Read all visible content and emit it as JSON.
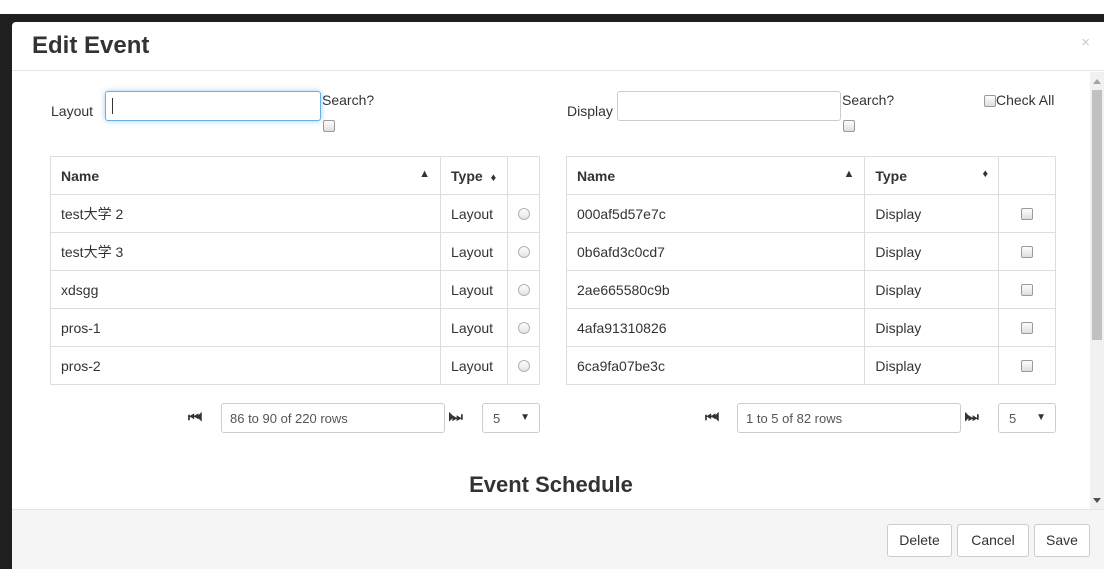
{
  "modal": {
    "title": "Edit Event",
    "close_symbol": "×"
  },
  "left_panel": {
    "filter_label": "Layout",
    "filter_value": "",
    "search_label": "Search?",
    "search_checked": false,
    "columns": [
      "Name",
      "Type"
    ],
    "sort_name": "▲",
    "sort_type": "♦",
    "rows": [
      {
        "name": "test大学 2",
        "type": "Layout"
      },
      {
        "name": "test大学 3",
        "type": "Layout"
      },
      {
        "name": "xdsgg",
        "type": "Layout"
      },
      {
        "name": "pros-1",
        "type": "Layout"
      },
      {
        "name": "pros-2",
        "type": "Layout"
      }
    ],
    "pager": {
      "first_prev_icons": "⏮⏴",
      "text": "86 to 90 of 220 rows",
      "next_last_icons": "⏵⏭",
      "page_size": "5",
      "dropdown_icon": "▼"
    }
  },
  "right_panel": {
    "filter_label": "Display",
    "filter_value": "",
    "search_label": "Search?",
    "search_checked": false,
    "check_all_label": "Check All",
    "columns": [
      "Name",
      "Type"
    ],
    "sort_name": "▲",
    "sort_type": "♦",
    "rows": [
      {
        "name": "000af5d57e7c",
        "type": "Display"
      },
      {
        "name": "0b6afd3c0cd7",
        "type": "Display"
      },
      {
        "name": "2ae665580c9b",
        "type": "Display"
      },
      {
        "name": "4afa91310826",
        "type": "Display"
      },
      {
        "name": "6ca9fa07be3c",
        "type": "Display"
      }
    ],
    "pager": {
      "first_prev_icons": "⏮⏴",
      "text": "1 to 5 of 82 rows",
      "next_last_icons": "⏵⏭",
      "page_size": "5",
      "dropdown_icon": "▼"
    }
  },
  "section": {
    "schedule_title": "Event Schedule"
  },
  "footer": {
    "delete_label": "Delete",
    "cancel_label": "Cancel",
    "save_label": "Save"
  },
  "colors": {
    "focus_border": "#66afe9",
    "footer_bg": "#f5f5f5",
    "backdrop": "#1f1f1f"
  }
}
